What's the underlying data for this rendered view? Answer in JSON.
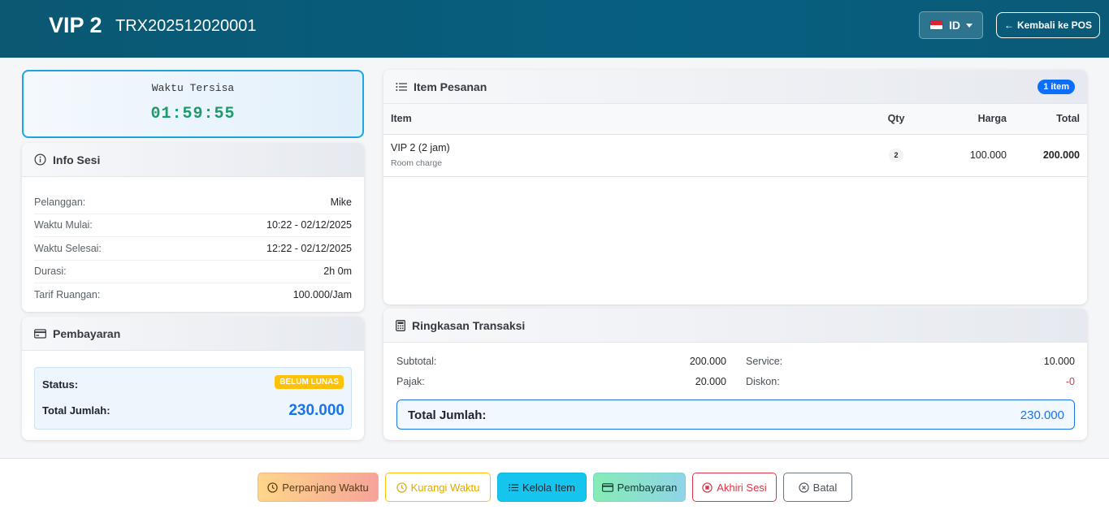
{
  "header": {
    "room": "VIP 2",
    "trx_id": "TRX202512020001",
    "language": "ID",
    "back_label": "Kembali ke POS"
  },
  "timer": {
    "label": "Waktu Tersisa",
    "value": "01:59:55"
  },
  "session_info": {
    "title": "Info Sesi",
    "rows": [
      {
        "key": "Pelanggan:",
        "value": "Mike"
      },
      {
        "key": "Waktu Mulai:",
        "value": "10:22 - 02/12/2025"
      },
      {
        "key": "Waktu Selesai:",
        "value": "12:22 - 02/12/2025"
      },
      {
        "key": "Durasi:",
        "value": "2h 0m"
      },
      {
        "key": "Tarif Ruangan:",
        "value": "100.000/Jam"
      }
    ]
  },
  "payment": {
    "title": "Pembayaran",
    "status_label": "Status:",
    "status_value": "BELUM LUNAS",
    "total_label": "Total Jumlah:",
    "total_value": "230.000"
  },
  "items": {
    "title": "Item Pesanan",
    "count_badge": "1 item",
    "columns": [
      "Item",
      "Qty",
      "Harga",
      "Total"
    ],
    "rows": [
      {
        "name": "VIP 2 (2 jam)",
        "sub": "Room charge",
        "qty": "2",
        "price": "100.000",
        "total": "200.000"
      }
    ]
  },
  "summary": {
    "title": "Ringkasan Transaksi",
    "subtotal_label": "Subtotal:",
    "subtotal_value": "200.000",
    "tax_label": "Pajak:",
    "tax_value": "20.000",
    "service_label": "Service:",
    "service_value": "10.000",
    "discount_label": "Diskon:",
    "discount_value": "-0",
    "total_label": "Total Jumlah:",
    "total_value": "230.000"
  },
  "footer": {
    "extend_label": "Perpanjang Waktu",
    "reduce_label": "Kurangi Waktu",
    "manage_label": "Kelola Item",
    "payment_label": "Pembayaran",
    "end_label": "Akhiri Sesi",
    "cancel_label": "Batal"
  },
  "colors": {
    "header_bg": "#075f80",
    "accent_blue": "#1a73e8",
    "timer_green": "#1f9a6a",
    "warning": "#ffc107",
    "danger": "#dc3545",
    "info": "#15c5ee"
  }
}
